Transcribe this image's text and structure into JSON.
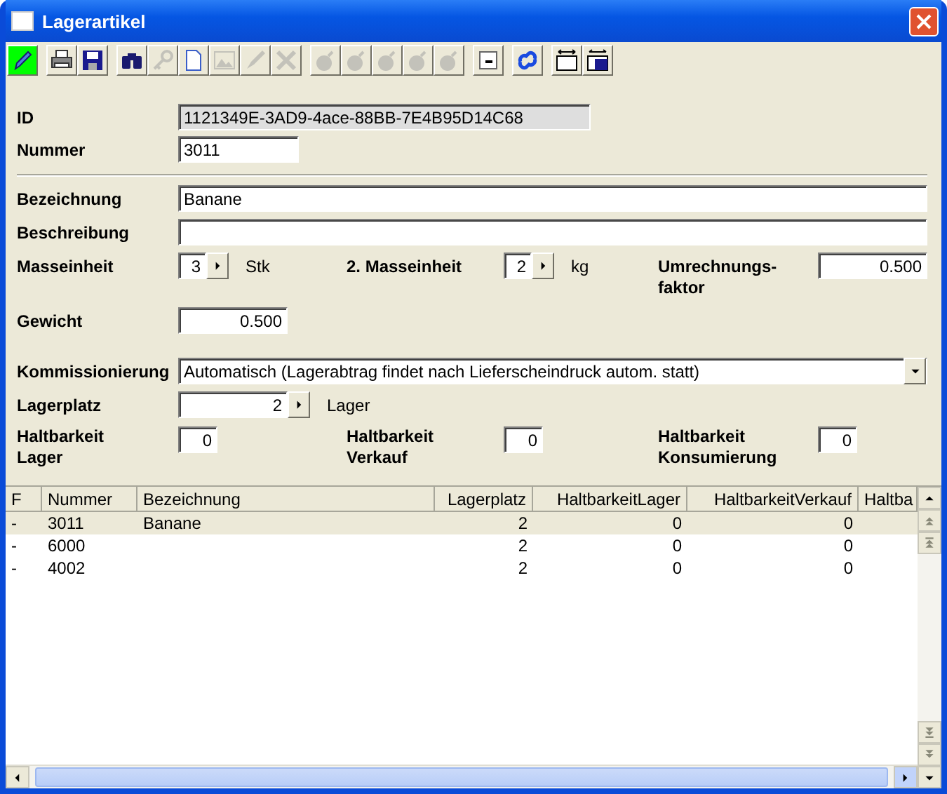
{
  "window": {
    "title": "Lagerartikel"
  },
  "toolbar": [
    [
      {
        "kind": "pencil",
        "disabled": false,
        "selected": true
      }
    ],
    [
      {
        "kind": "printer",
        "disabled": false,
        "selected": false
      },
      {
        "kind": "save",
        "disabled": false,
        "selected": false
      }
    ],
    [
      {
        "kind": "binoculars",
        "disabled": false,
        "selected": false
      },
      {
        "kind": "key",
        "disabled": true,
        "selected": false
      },
      {
        "kind": "document",
        "disabled": false,
        "selected": false
      },
      {
        "kind": "picture",
        "disabled": true,
        "selected": false
      },
      {
        "kind": "pen",
        "disabled": true,
        "selected": false
      },
      {
        "kind": "delete",
        "disabled": true,
        "selected": false
      }
    ],
    [
      {
        "kind": "bomb",
        "disabled": true,
        "selected": false
      },
      {
        "kind": "bomb",
        "disabled": true,
        "selected": false
      },
      {
        "kind": "bomb",
        "disabled": true,
        "selected": false
      },
      {
        "kind": "bomb",
        "disabled": true,
        "selected": false
      },
      {
        "kind": "bomb",
        "disabled": true,
        "selected": false
      }
    ],
    [
      {
        "kind": "minimize",
        "disabled": false,
        "selected": false
      }
    ],
    [
      {
        "kind": "link",
        "disabled": false,
        "selected": false
      }
    ],
    [
      {
        "kind": "fit",
        "disabled": false,
        "selected": false
      },
      {
        "kind": "savefit",
        "disabled": false,
        "selected": false
      }
    ]
  ],
  "id": {
    "label": "ID",
    "value": "1121349E-3AD9-4ace-88BB-7E4B95D14C68",
    "readonly": true
  },
  "nummer": {
    "label": "Nummer",
    "value": "3011"
  },
  "bezeichnung": {
    "label": "Bezeichnung",
    "value": "Banane"
  },
  "beschreibung": {
    "label": "Beschreibung"
  },
  "masseinheit": {
    "label": "Masseinheit",
    "value": "3",
    "unit": "Stk"
  },
  "masseinheit2": {
    "label": "2. Masseinheit",
    "value": "2",
    "unit": "kg"
  },
  "umrechnungsfaktor": {
    "label": "Umrechnungs-faktor",
    "value": "0.500"
  },
  "gewicht": {
    "label": "Gewicht",
    "value": "0.500"
  },
  "kommissionierung": {
    "label": "Kommissionierung",
    "value": "Automatisch (Lagerabtrag findet nach Lieferscheindruck autom. statt)"
  },
  "lagerplatz": {
    "label": "Lagerplatz",
    "value": "2",
    "unit": "Lager"
  },
  "haltbarkeit": [
    {
      "label": "Haltbarkeit Lager",
      "value": "0"
    },
    {
      "label": "Haltbarkeit Verkauf",
      "value": "0"
    },
    {
      "label": "Haltbarkeit Konsumierung",
      "value": "0"
    }
  ],
  "table": {
    "columns": [
      {
        "label": "F"
      },
      {
        "label": "Nummer"
      },
      {
        "label": "Bezeichnung"
      },
      {
        "label": "Lagerplatz"
      },
      {
        "label": "HaltbarkeitLager"
      },
      {
        "label": "HaltbarkeitVerkauf"
      },
      {
        "label": "Haltba"
      }
    ],
    "rows": [
      {
        "selected": true,
        "cells": [
          "-",
          "3011",
          "Banane",
          "2",
          "0",
          "0"
        ]
      },
      {
        "selected": false,
        "cells": [
          "-",
          "6000",
          "",
          "2",
          "0",
          "0"
        ]
      },
      {
        "selected": false,
        "cells": [
          "-",
          "4002",
          "",
          "2",
          "0",
          "0"
        ]
      }
    ]
  }
}
